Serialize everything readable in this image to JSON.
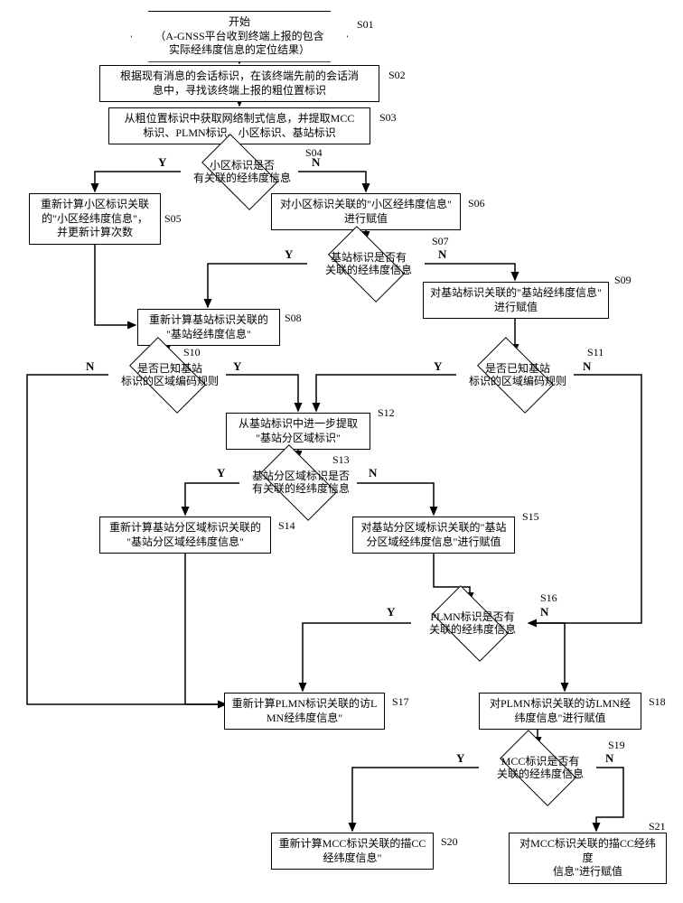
{
  "labels": {
    "s01": "开始\n（A-GNSS平台收到终端上报的包含\n实际经纬度信息的定位结果）",
    "s02": "根据现有消息的会话标识，在该终端先前的会话消\n息中，寻找该终端上报的粗位置标识",
    "s03": "从粗位置标识中获取网络制式信息，并提取MCC\n标识、PLMN标识、小区标识、基站标识",
    "d04": "小区标识是否\n有关联的经纬度信息",
    "s05": "重新计算小区标识关联\n的\"小区经纬度信息\"，\n并更新计算次数",
    "s06": "对小区标识关联的\"小区经纬度信息\"\n进行赋值",
    "d07": "基站标识是否有\n关联的经纬度信息",
    "s08": "重新计算基站标识关联的\n\"基站经纬度信息\"",
    "s09": "对基站标识关联的\"基站经纬度信息\"\n进行赋值",
    "d10": "是否已知基站\n标识的区域编码规则",
    "d11": "是否已知基站\n标识的区域编码规则",
    "s12": "从基站标识中进一步提取\n\"基站分区域标识\"",
    "d13": "基站分区域标识是否\n有关联的经纬度信息",
    "s14": "重新计算基站分区域标识关联的\n\"基站分区域经纬度信息\"",
    "s15": "对基站分区域标识关联的\"基站\n分区域经纬度信息\"进行赋值",
    "d16": "PLMN标识是否有\n关联的经纬度信息",
    "s17": "重新计算PLMN标识关联的访L\nMN经纬度信息\"",
    "s18": "对PLMN标识关联的访LMN经\n纬度信息\"进行赋值",
    "d19": "MCC标识是否有\n关联的经纬度信息",
    "s20": "重新计算MCC标识关联的描CC\n经纬度信息\"",
    "s21": "对MCC标识关联的描CC经纬度\n信息\"进行赋值"
  },
  "steps": {
    "s01": "S01",
    "s02": "S02",
    "s03": "S03",
    "s04": "S04",
    "s05": "S05",
    "s06": "S06",
    "s07": "S07",
    "s08": "S08",
    "s09": "S09",
    "s10": "S10",
    "s11": "S11",
    "s12": "S12",
    "s13": "S13",
    "s14": "S14",
    "s15": "S15",
    "s16": "S16",
    "s17": "S17",
    "s18": "S18",
    "s19": "S19",
    "s20": "S20",
    "s21": "S21"
  },
  "yn": {
    "y": "Y",
    "n": "N"
  }
}
